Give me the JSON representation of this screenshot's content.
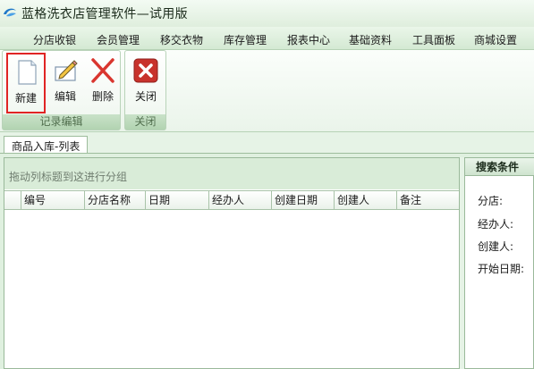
{
  "window": {
    "title": "蓝格洗衣店管理软件—试用版"
  },
  "menu": [
    "分店收银",
    "会员管理",
    "移交衣物",
    "库存管理",
    "报表中心",
    "基础资料",
    "工具面板",
    "商城设置"
  ],
  "ribbon": {
    "record_group": {
      "label": "记录编辑",
      "buttons": [
        "新建",
        "编辑",
        "删除"
      ],
      "selected": "新建"
    },
    "close_group": {
      "label": "关闭",
      "buttons": [
        "关闭"
      ]
    }
  },
  "tabs": [
    {
      "label": "商品入库-列表",
      "active": true
    }
  ],
  "grid": {
    "group_hint": "拖动列标题到这进行分组",
    "columns": [
      "编号",
      "分店名称",
      "日期",
      "经办人",
      "创建日期",
      "创建人",
      "备注"
    ],
    "rows": []
  },
  "search": {
    "title": "搜索条件",
    "fields": [
      "分店:",
      "经办人:",
      "创建人:",
      "开始日期:"
    ]
  },
  "colors": {
    "accent_green": "#b2d3b1",
    "selection_red": "#e02424",
    "delete_red": "#d9362f",
    "close_red": "#c8322c"
  },
  "icons": {
    "new": "new-document-icon",
    "edit": "edit-pencil-icon",
    "delete": "delete-x-icon",
    "close": "close-icon"
  }
}
